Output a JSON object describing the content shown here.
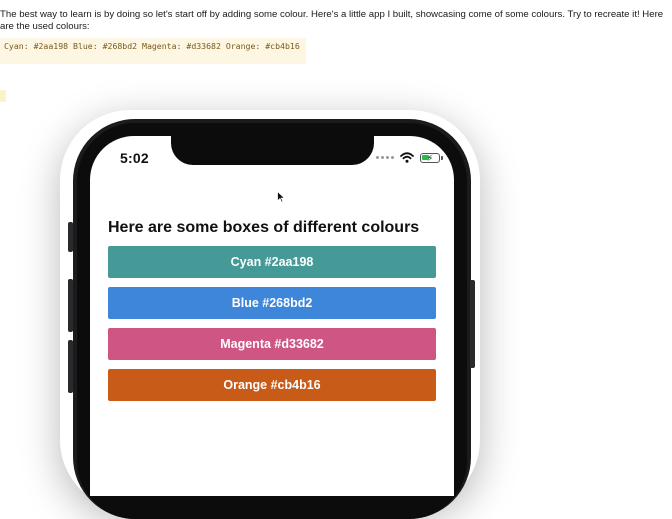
{
  "intro": {
    "text": "The best way to learn is by doing so let's start off by adding some colour. Here's a little app I built, showcasing come of some colours. Try to recreate it! Here are the used colours:",
    "code": "Cyan: #2aa198 Blue: #268bd2 Magenta: #d33682 Orange: #cb4b16"
  },
  "phone": {
    "status_bar": {
      "time": "5:02",
      "icons": [
        "signal-dots-icon",
        "wifi-icon",
        "battery-charging-icon"
      ],
      "battery_level": 0.45
    },
    "heading": "Here are some boxes of different colours",
    "boxes": [
      {
        "label": "Cyan #2aa198",
        "color": "#459a98"
      },
      {
        "label": "Blue #268bd2",
        "color": "#3d86da"
      },
      {
        "label": "Magenta #d33682",
        "color": "#cf5585"
      },
      {
        "label": "Orange #cb4b16",
        "color": "#c75b17"
      }
    ]
  }
}
